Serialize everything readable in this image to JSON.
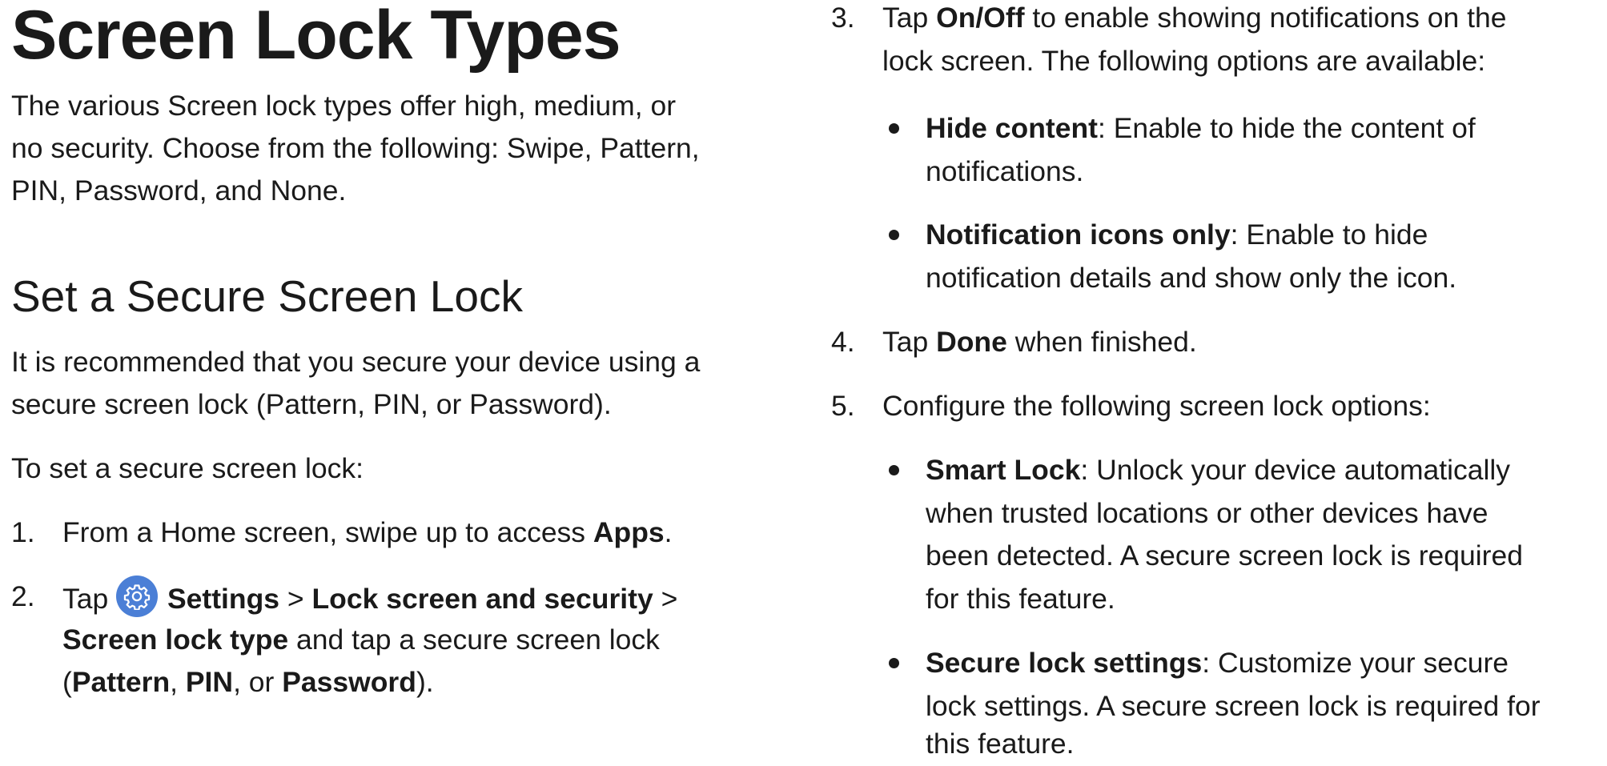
{
  "left": {
    "title": "Screen Lock Types",
    "intro_lines": [
      "The various Screen lock types offer high, medium, or",
      "no security. Choose from the following: Swipe, Pattern,",
      "PIN, Password, and None."
    ],
    "section_title": "Set a Secure Screen Lock",
    "recommend_lines": [
      "It is recommended that you secure your device using a",
      "secure screen lock (Pattern, PIN, or Password)."
    ],
    "to_set": "To set a secure screen lock:",
    "step1": {
      "num": "1.",
      "pre": "From a Home screen, swipe up to access ",
      "bold": "Apps",
      "post": "."
    },
    "step2": {
      "num": "2.",
      "line1_pre": "Tap ",
      "settings": "Settings",
      "sep1": " > ",
      "lock_screen": "Lock screen and security",
      "sep2": " >",
      "screen_lock_type": "Screen lock type",
      "line2_post": " and tap a secure screen lock",
      "paren_open": "(",
      "pattern": "Pattern",
      "comma1": ", ",
      "pin": "PIN",
      "or": ", or ",
      "password": "Password",
      "paren_close": ")."
    }
  },
  "right": {
    "step3": {
      "num": "3.",
      "pre": "Tap ",
      "bold": "On/Off",
      "post": " to enable showing notifications on the",
      "line2": "lock screen. The following options are available:"
    },
    "bullet_hide": {
      "bold": "Hide content",
      "post": ": Enable to hide the content of",
      "line2": "notifications."
    },
    "bullet_icons": {
      "bold": "Notification icons only",
      "post": ": Enable to hide",
      "line2": "notification details and show only the icon."
    },
    "step4": {
      "num": "4.",
      "pre": "Tap ",
      "bold": "Done",
      "post": " when finished."
    },
    "step5": {
      "num": "5.",
      "text": "Configure the following screen lock options:"
    },
    "bullet_smart": {
      "bold": "Smart Lock",
      "post": ": Unlock your device automatically",
      "line2": "when trusted locations or other devices have",
      "line3": "been detected. A secure screen lock is required",
      "line4": "for this feature."
    },
    "bullet_secure": {
      "bold": "Secure lock settings",
      "post": ": Customize your secure",
      "line2": "lock settings. A secure screen lock is required for",
      "line3": "this feature."
    }
  },
  "icons": {
    "settings": "gear-icon"
  },
  "colors": {
    "text": "#1a1a1a",
    "settings_icon_bg": "#4b7fd6"
  }
}
